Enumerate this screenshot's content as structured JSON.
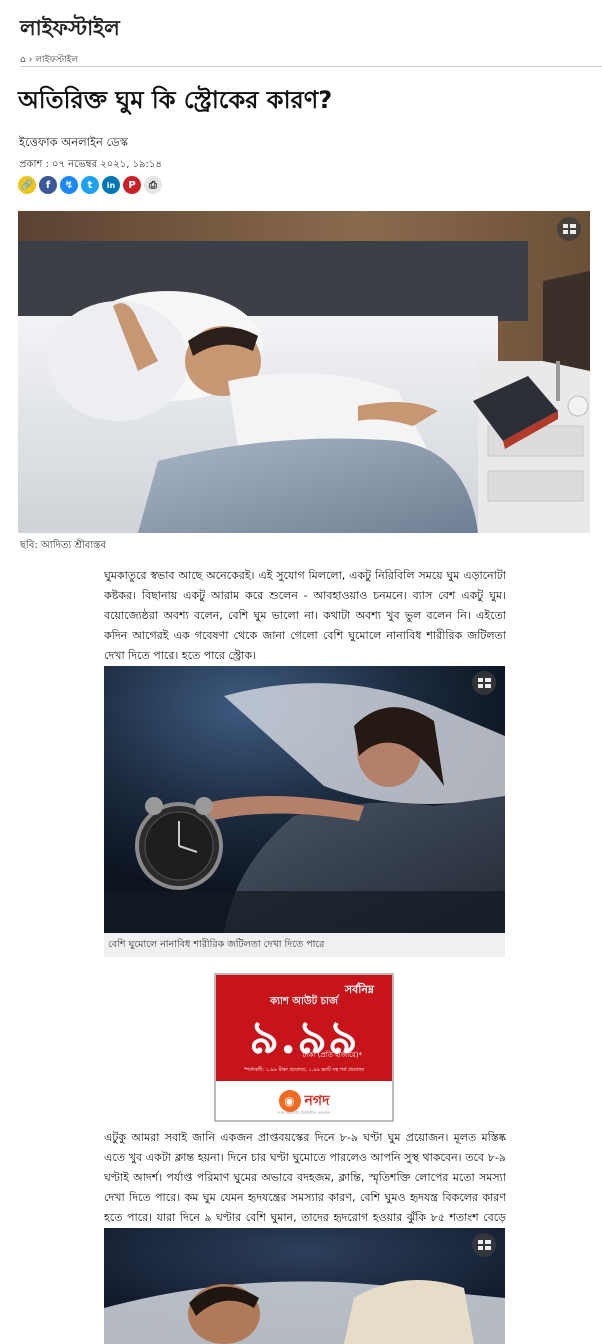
{
  "header": {
    "section_title": "লাইফস্টাইল"
  },
  "breadcrumb": {
    "home_icon": "home-icon",
    "separator": "›",
    "current": "লাইফস্টাইল"
  },
  "article": {
    "headline": "অতিরিক্ত ঘুম কি স্ট্রোকের কারণ?",
    "author": "ইত্তেফাক অনলাইন ডেস্ক",
    "published": "প্রকাশ : ০৭ নভেম্বর ২০২১, ১৯:১৪",
    "share_buttons": [
      {
        "name": "copy-link-icon",
        "glyph": "⛓",
        "color": "#f0c419"
      },
      {
        "name": "facebook-icon",
        "glyph": "f",
        "color": "#3b5998"
      },
      {
        "name": "messenger-icon",
        "glyph": "ϟ",
        "color": "#1e88f5"
      },
      {
        "name": "twitter-icon",
        "glyph": "t",
        "color": "#1da1f2"
      },
      {
        "name": "linkedin-icon",
        "glyph": "in",
        "color": "#0077b5"
      },
      {
        "name": "pinterest-icon",
        "glyph": "P",
        "color": "#cb2027"
      },
      {
        "name": "print-icon",
        "glyph": "⎙",
        "color": "#e8e8e8"
      }
    ],
    "hero_caption": "ছবি: আদিত্য শ্রীবাস্তব",
    "paragraph_1": "ঘুমকাতুরে স্বভাব আছে অনেকেরই। এই সুযোগ মিললো, একটু নিরিবিলি সময়ে ঘুম এড়ানোটা কষ্টকর। বিছানায় একটু আরাম করে শুলেন - আবহাওয়াও চনমনে। ব্যাস বেশ একটু ঘুম। বয়োজ্যেষ্ঠরা অবশ্য বলেন, বেশি ঘুম ভালো না। কথাটা অবশ্য খুব ভুল বলেন নি। এইতো কদিন আগেরই এক গবেষণা থেকে জানা গেলো বেশি ঘুমোলে নানাবিধ শারীরিক জটিলতা দেখা দিতে পারে। হতে পারে স্ট্রোক।",
    "inline_caption": "বেশি ঘুমোলে নানাবিধ শারীরিক জটিলতা দেখা দিতে পারে",
    "paragraph_2": "এটুকু আমরা সবাই জানি একজন প্রাপ্তবয়স্কের দিনে ৮-৯ ঘণ্টা ঘুম প্রয়োজন। মূলত মস্তিষ্ক এতে খুব একটা ক্লান্ত হয়না। দিনে চার ঘণ্টা ঘুমোতে পারলেও আপনি সুস্থ থাকবেন। তবে ৮-৯ ঘণ্টাই আদর্শ। পর্যাপ্ত পরিমাণ ঘুমের অভাবে বদহজম, ক্লান্তি, স্মৃতিশক্তি লোপের মতো সমস্যা দেখা দিতে পারে। কম ঘুম যেমন হৃদযন্ত্রের সমস্যার কারণ, বেশি ঘুমও হৃদযন্ত্র বিকলের কারণ হতে পারে। যারা দিনে ৯ ঘণ্টার বেশি ঘুমান, তাদের হৃদরোগ হওয়ার ঝুঁকি ৮৫ শতাংশ বেড়ে যায়।"
  },
  "ad": {
    "line_1": "সর্বনিম্ন",
    "line_2": "ক্যাশ আউট চার্জ",
    "amount": "৯.৯৯",
    "line_3": "টাকা (প্রতি হাজারে)*",
    "fine_print": "*শর্তাবলী: ১.৯৯ টাকা প্রযোজ্য, ১.৯৯ ভ্যাট সহ শর্ত প্রযোজ্য",
    "brand": "নগদ",
    "brand_sub": "ডাক বিভাগের ডিজিটাল লেনদেন"
  }
}
